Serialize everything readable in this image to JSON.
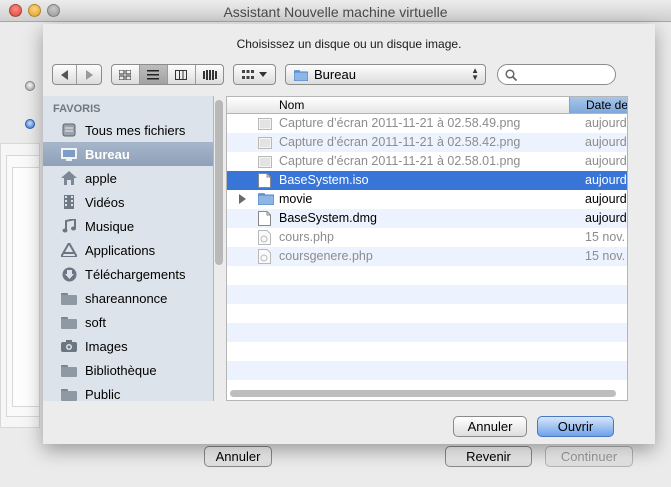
{
  "window": {
    "title": "Assistant Nouvelle machine virtuelle"
  },
  "dialog": {
    "prompt": "Choisissez un disque ou un disque image.",
    "location": "Bureau",
    "search_placeholder": "",
    "sidebar": {
      "header": "FAVORIS",
      "items": [
        {
          "label": "Tous mes fichiers",
          "icon": "all-files-icon"
        },
        {
          "label": "Bureau",
          "icon": "desktop-icon",
          "selected": true
        },
        {
          "label": "apple",
          "icon": "home-icon"
        },
        {
          "label": "Vidéos",
          "icon": "movies-icon"
        },
        {
          "label": "Musique",
          "icon": "music-icon"
        },
        {
          "label": "Applications",
          "icon": "applications-icon"
        },
        {
          "label": "Téléchargements",
          "icon": "downloads-icon"
        },
        {
          "label": "shareannonce",
          "icon": "folder-icon"
        },
        {
          "label": "soft",
          "icon": "folder-icon"
        },
        {
          "label": "Images",
          "icon": "camera-icon"
        },
        {
          "label": "Bibliothèque",
          "icon": "folder-icon"
        },
        {
          "label": "Public",
          "icon": "folder-icon"
        }
      ]
    },
    "columns": {
      "name": "Nom",
      "date": "Date de"
    },
    "files": [
      {
        "name": "Capture d’écran 2011-11-21 à 02.58.49.png",
        "date": "aujourd",
        "kind": "image",
        "dim": true
      },
      {
        "name": "Capture d’écran 2011-11-21 à 02.58.42.png",
        "date": "aujourd",
        "kind": "image",
        "dim": true
      },
      {
        "name": "Capture d’écran 2011-11-21 à 02.58.01.png",
        "date": "aujourd",
        "kind": "image",
        "dim": true
      },
      {
        "name": "BaseSystem.iso",
        "date": "aujourd",
        "kind": "document",
        "selected": true
      },
      {
        "name": "movie",
        "date": "aujourd",
        "kind": "folder",
        "expandable": true
      },
      {
        "name": "BaseSystem.dmg",
        "date": "aujourd",
        "kind": "document"
      },
      {
        "name": "cours.php",
        "date": "15 nov.",
        "kind": "script",
        "dim": true
      },
      {
        "name": "coursgenere.php",
        "date": "15 nov.",
        "kind": "script",
        "dim": true
      }
    ],
    "cancel_label": "Annuler",
    "open_label": "Ouvrir"
  },
  "assistant": {
    "cancel_label": "Annuler",
    "back_label": "Revenir",
    "continue_label": "Continuer"
  },
  "colors": {
    "selection": "#3875d7",
    "sidebar_bg": "#dde3ea",
    "default_button": "#6ea2ea"
  }
}
